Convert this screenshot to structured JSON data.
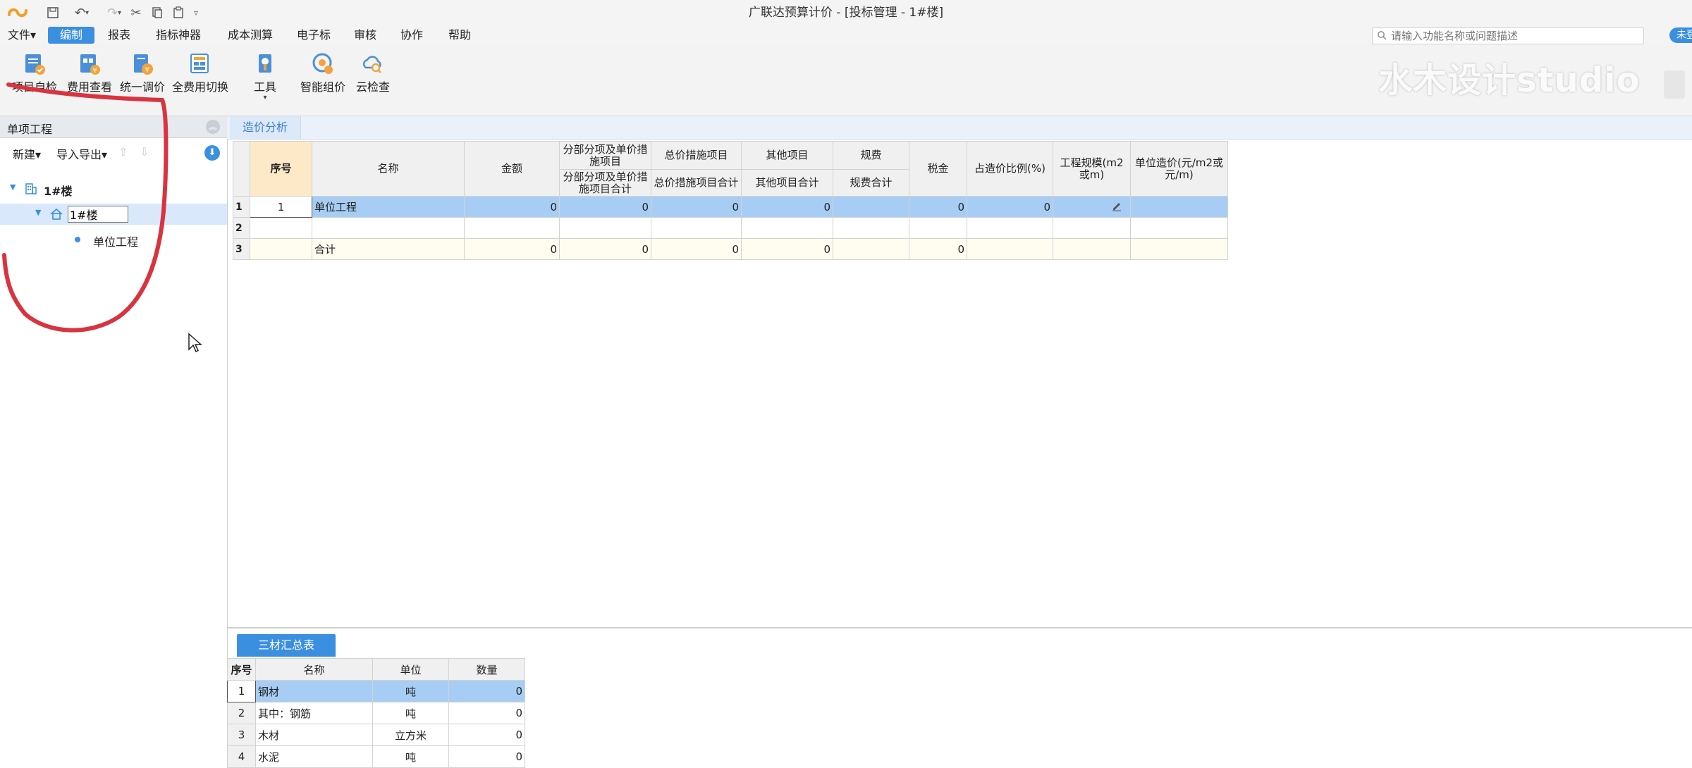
{
  "window": {
    "title": "广联达预算计价 - [投标管理 - 1#楼]"
  },
  "menu": {
    "file": "文件▾",
    "tabs": [
      "编制",
      "报表",
      "指标神器",
      "成本测算",
      "电子标",
      "审核",
      "协作",
      "帮助"
    ],
    "active_tab": "编制",
    "search_placeholder": "请输入功能名称或问题描述",
    "login": "未登"
  },
  "ribbon": {
    "buttons": [
      "项目自检",
      "费用查看",
      "统一调价",
      "全费用切换",
      "工具",
      "智能组价",
      "云检查"
    ],
    "watermark": "水木设计studio"
  },
  "left_panel": {
    "title": "单项工程",
    "new_label": "新建▾",
    "import_export_label": "导入导出▾",
    "tree": {
      "root": "1#楼",
      "child_edit_value": "1#楼",
      "leaf": "单位工程"
    }
  },
  "main": {
    "tab": "造价分析",
    "headers": {
      "seq": "序号",
      "name": "名称",
      "amount": "金额",
      "fbfx_top": "分部分项及单价措施项目",
      "fbfx_bottom": "分部分项及单价措施项目合计",
      "zj_top": "总价措施项目",
      "zj_bottom": "总价措施项目合计",
      "qt_top": "其他项目",
      "qt_bottom": "其他项目合计",
      "gf_top": "规费",
      "gf_bottom": "规费合计",
      "tax": "税金",
      "ratio": "占造价比例(%)",
      "scale": "工程规模(m2或m)",
      "unit_cost": "单位造价(元/m2或元/m)"
    },
    "rows": [
      {
        "rn": "1",
        "seq": "1",
        "name": "单位工程",
        "amount": "0",
        "fbfx": "0",
        "zj": "0",
        "qt": "0",
        "gf": "",
        "tax": "0",
        "ratio": "0",
        "scale": "",
        "unit_cost": ""
      },
      {
        "rn": "2",
        "seq": "",
        "name": "",
        "amount": "",
        "fbfx": "",
        "zj": "",
        "qt": "",
        "gf": "",
        "tax": "",
        "ratio": "",
        "scale": "",
        "unit_cost": ""
      },
      {
        "rn": "3",
        "seq": "",
        "name": "合计",
        "amount": "0",
        "fbfx": "0",
        "zj": "0",
        "qt": "0",
        "gf": "",
        "tax": "0",
        "ratio": "",
        "scale": "",
        "unit_cost": ""
      }
    ]
  },
  "bottom": {
    "tab": "三材汇总表",
    "headers": {
      "seq": "序号",
      "name": "名称",
      "unit": "单位",
      "qty": "数量"
    },
    "rows": [
      {
        "rn": "1",
        "name": "钢材",
        "unit": "吨",
        "qty": "0"
      },
      {
        "rn": "2",
        "name": "其中：钢筋",
        "unit": "吨",
        "qty": "0"
      },
      {
        "rn": "3",
        "name": "木材",
        "unit": "立方米",
        "qty": "0"
      },
      {
        "rn": "4",
        "name": "水泥",
        "unit": "吨",
        "qty": "0"
      }
    ]
  },
  "colors": {
    "accent": "#3b8fe0",
    "selection": "#a7cdf5",
    "annotation": "#d9333f"
  }
}
